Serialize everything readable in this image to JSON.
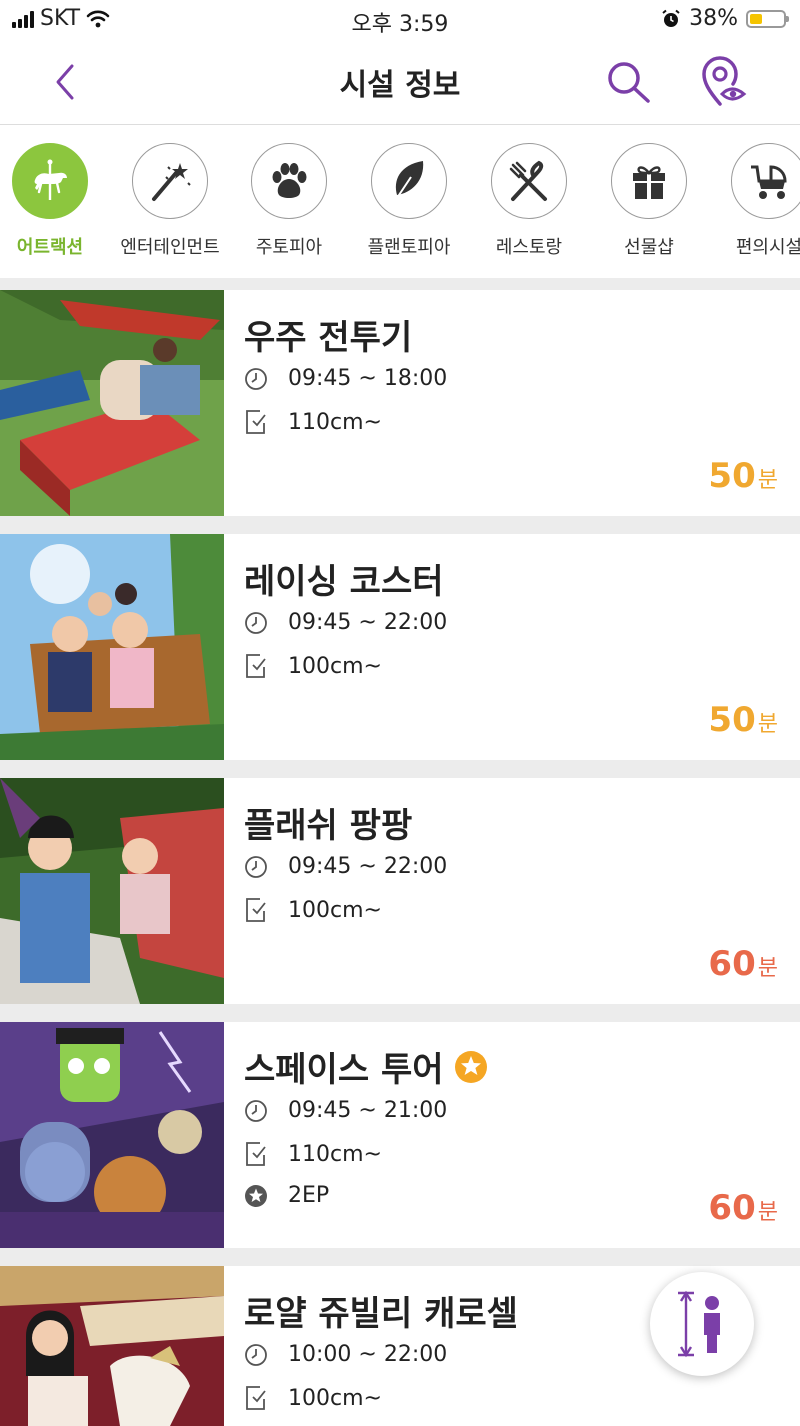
{
  "status_bar": {
    "carrier": "SKT",
    "time": "오후 3:59",
    "battery": "38%",
    "battery_level": 0.38
  },
  "header": {
    "title": "시설 정보"
  },
  "categories": [
    {
      "label": "어트랙션",
      "icon": "carousel-horse-icon",
      "active": true
    },
    {
      "label": "엔터테인먼트",
      "icon": "magic-wand-icon",
      "active": false
    },
    {
      "label": "주토피아",
      "icon": "paw-icon",
      "active": false
    },
    {
      "label": "플랜토피아",
      "icon": "leaf-icon",
      "active": false
    },
    {
      "label": "레스토랑",
      "icon": "fork-knife-icon",
      "active": false
    },
    {
      "label": "선물샵",
      "icon": "gift-icon",
      "active": false
    },
    {
      "label": "편의시설",
      "icon": "stroller-icon",
      "active": false
    }
  ],
  "colors": {
    "accent_purple": "#7b3fa8",
    "active_green": "#8cc63e",
    "wait_orange": "#f0a830",
    "wait_red": "#e8694a",
    "star_orange": "#f5a623"
  },
  "attractions": [
    {
      "name": "우주 전투기",
      "hours": "09:45 ~ 18:00",
      "height": "110cm~",
      "ep": "",
      "featured": false,
      "wait_num": "50",
      "wait_unit": "분",
      "wait_color": "#f0a830"
    },
    {
      "name": "레이싱 코스터",
      "hours": "09:45 ~ 22:00",
      "height": "100cm~",
      "ep": "",
      "featured": false,
      "wait_num": "50",
      "wait_unit": "분",
      "wait_color": "#f0a830"
    },
    {
      "name": "플래쉬 팡팡",
      "hours": "09:45 ~ 22:00",
      "height": "100cm~",
      "ep": "",
      "featured": false,
      "wait_num": "60",
      "wait_unit": "분",
      "wait_color": "#e8694a"
    },
    {
      "name": "스페이스 투어",
      "hours": "09:45 ~ 21:00",
      "height": "110cm~",
      "ep": "2EP",
      "featured": true,
      "wait_num": "60",
      "wait_unit": "분",
      "wait_color": "#e8694a"
    },
    {
      "name": "로얄 쥬빌리 캐로셀",
      "hours": "10:00 ~ 22:00",
      "height": "100cm~",
      "ep": "",
      "featured": false,
      "wait_num": "",
      "wait_unit": "",
      "wait_color": "#f0a830"
    }
  ]
}
